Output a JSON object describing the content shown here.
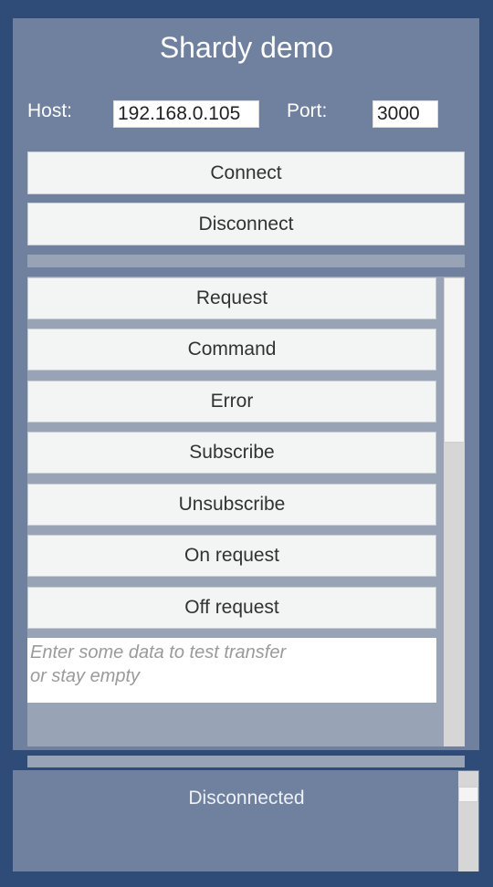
{
  "app": {
    "title": "Shardy demo"
  },
  "connection": {
    "host_label": "Host:",
    "host_value": "192.168.0.105",
    "port_label": "Port:",
    "port_value": "3000",
    "connect_label": "Connect",
    "disconnect_label": "Disconnect"
  },
  "actions": {
    "items": [
      {
        "label": "Request"
      },
      {
        "label": "Command"
      },
      {
        "label": "Error"
      },
      {
        "label": "Subscribe"
      },
      {
        "label": "Unsubscribe"
      },
      {
        "label": "On request"
      },
      {
        "label": "Off request"
      }
    ],
    "data_placeholder": "Enter some data to test transfer\nor stay empty"
  },
  "status": {
    "text": "Disconnected"
  },
  "colors": {
    "background": "#2f4b78",
    "panel": "#6f819f",
    "button": "#f3f5f5",
    "scroll_track": "#98a3b5"
  }
}
